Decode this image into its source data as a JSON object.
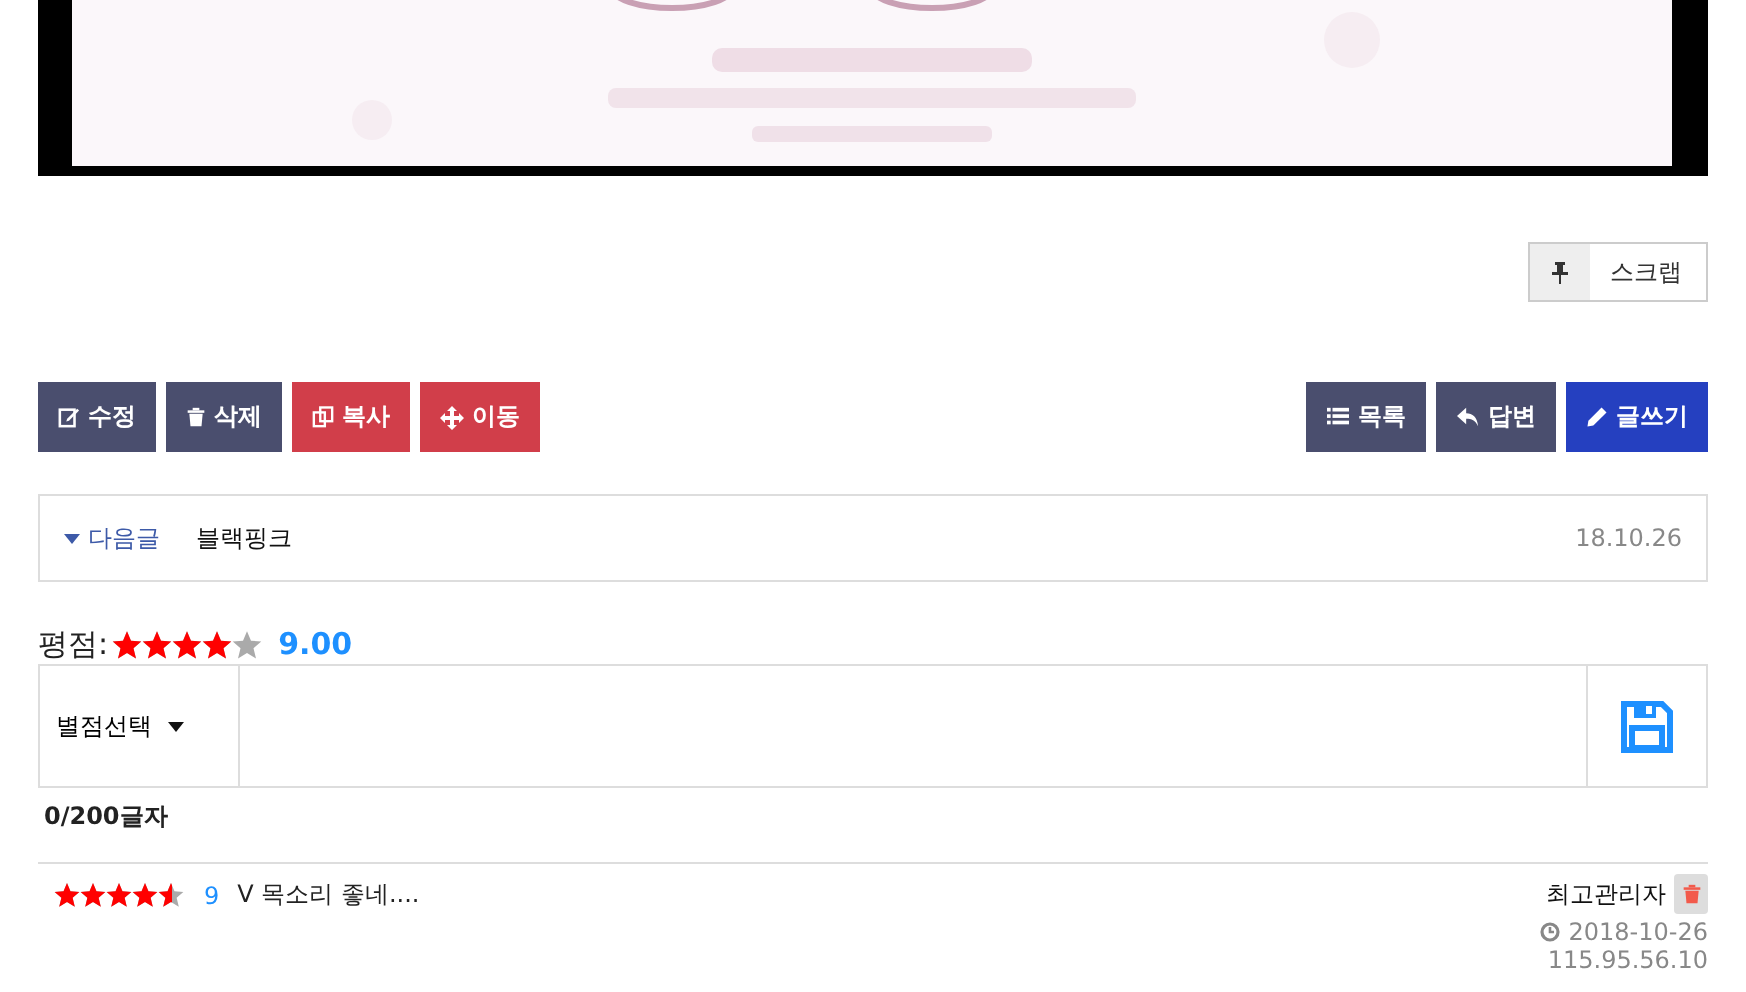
{
  "scrap_button": {
    "label": "스크랩"
  },
  "actions_left": [
    {
      "label": "수정",
      "kind": "edit"
    },
    {
      "label": "삭제",
      "kind": "delete"
    },
    {
      "label": "복사",
      "kind": "copy"
    },
    {
      "label": "이동",
      "kind": "move"
    }
  ],
  "actions_right": [
    {
      "label": "목록",
      "kind": "list"
    },
    {
      "label": "답변",
      "kind": "reply"
    },
    {
      "label": "글쓰기",
      "kind": "write"
    }
  ],
  "next_post": {
    "label": "다음글",
    "title": "블랙핑크",
    "date": "18.10.26"
  },
  "rating": {
    "label": "평점:",
    "stars": 4,
    "score": "9.00"
  },
  "comment_form": {
    "select_label": "별점선택",
    "char_count": "0/200글자"
  },
  "comments": [
    {
      "stars": 4.5,
      "score": "9",
      "text": "V 목소리 좋네....",
      "author": "최고관리자",
      "date": "2018-10-26",
      "ip": "115.95.56.10"
    }
  ]
}
